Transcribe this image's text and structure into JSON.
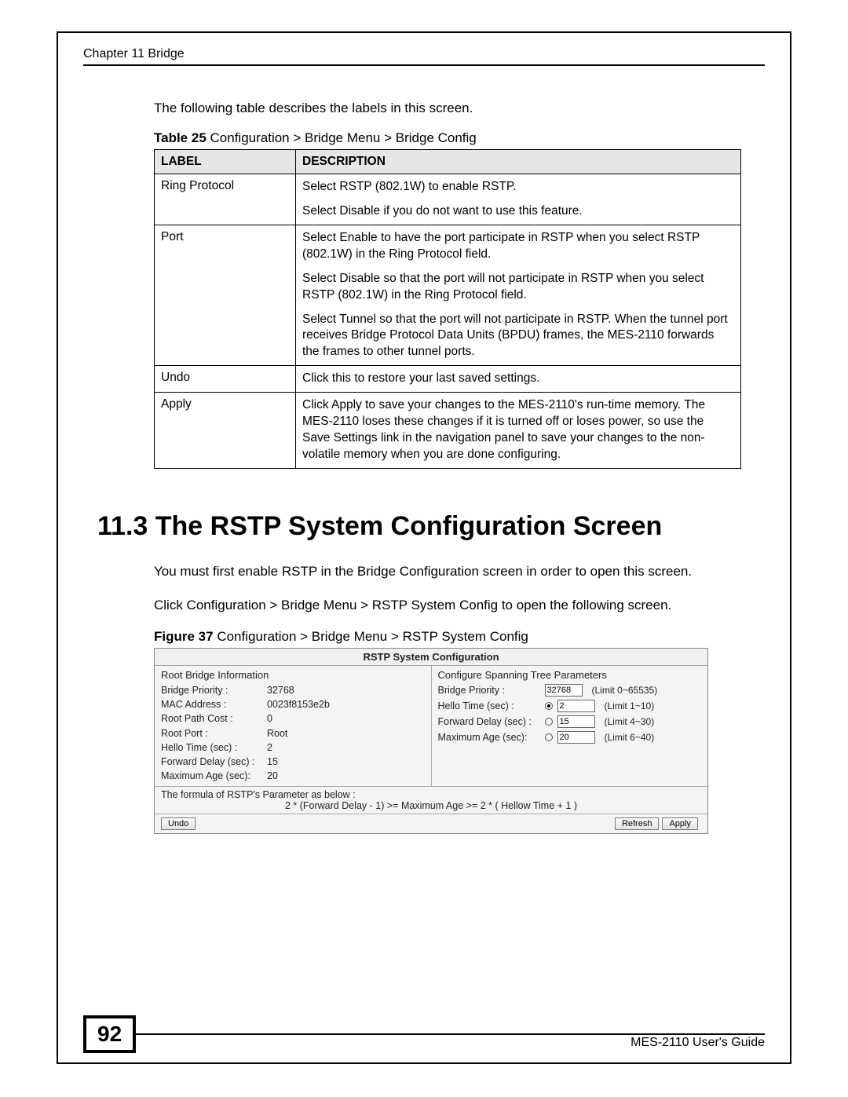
{
  "header": "Chapter 11 Bridge",
  "intro": "The following table describes the labels in this screen.",
  "table_caption_bold": "Table 25",
  "table_caption_rest": "   Configuration > Bridge Menu > Bridge Config",
  "table_headers": {
    "label": "LABEL",
    "desc": "DESCRIPTION"
  },
  "rows": [
    {
      "label": "Ring Protocol",
      "paras": [
        "Select RSTP (802.1W) to enable RSTP.",
        "Select Disable if you do not want to use this feature."
      ]
    },
    {
      "label": "Port",
      "paras": [
        "Select Enable to have the port participate in RSTP when you select RSTP (802.1W) in the Ring Protocol field.",
        "Select Disable so that the port will not participate in RSTP when you select RSTP (802.1W) in the Ring Protocol field.",
        "Select Tunnel so that the port will not participate in RSTP. When the tunnel port receives Bridge Protocol Data Units (BPDU) frames, the MES-2110 forwards the frames to other tunnel ports."
      ]
    },
    {
      "label": "Undo",
      "paras": [
        "Click this to restore your last saved settings."
      ]
    },
    {
      "label": "Apply",
      "paras": [
        "Click Apply to save your changes to the MES-2110's run-time memory. The MES-2110 loses these changes if it is turned off or loses power, so use the Save Settings link in the navigation panel to save your changes to the non-volatile memory when you are done configuring."
      ]
    }
  ],
  "section_heading": "11.3  The RSTP System Configuration Screen",
  "para1": "You must first enable RSTP in the Bridge Configuration screen in order to open this screen.",
  "para2": "Click Configuration > Bridge Menu > RSTP System Config to open the following screen.",
  "figure_caption_bold": "Figure 37",
  "figure_caption_rest": "   Configuration > Bridge Menu > RSTP System Config",
  "figure": {
    "title": "RSTP System Configuration",
    "left_head": "Root Bridge Information",
    "right_head": "Configure Spanning Tree Parameters",
    "left_rows": [
      {
        "k": "Bridge Priority :",
        "v": "32768"
      },
      {
        "k": "MAC Address :",
        "v": "0023f8153e2b"
      },
      {
        "k": "Root Path Cost :",
        "v": "0"
      },
      {
        "k": "Root Port :",
        "v": "Root"
      },
      {
        "k": "Hello Time (sec) :",
        "v": "2"
      },
      {
        "k": "Forward Delay (sec) :",
        "v": "15"
      },
      {
        "k": "Maximum Age (sec):",
        "v": "20"
      }
    ],
    "right_rows": [
      {
        "label": "Bridge Priority :",
        "value": "32768",
        "limit": "(Limit 0~65535)",
        "radio": false,
        "checked": false
      },
      {
        "label": "Hello Time (sec) :",
        "value": "2",
        "limit": "(Limit 1~10)",
        "radio": true,
        "checked": true
      },
      {
        "label": "Forward Delay (sec) :",
        "value": "15",
        "limit": "(Limit 4~30)",
        "radio": true,
        "checked": false
      },
      {
        "label": "Maximum Age (sec):",
        "value": "20",
        "limit": "(Limit 6~40)",
        "radio": true,
        "checked": false
      }
    ],
    "formula_label": "The formula of RSTP's Parameter as below :",
    "formula": "2 * (Forward Delay - 1) >= Maximum Age >= 2 * ( Hellow Time + 1 )",
    "buttons": {
      "undo": "Undo",
      "refresh": "Refresh",
      "apply": "Apply"
    }
  },
  "page_number": "92",
  "footer_text": "MES-2110 User's Guide"
}
